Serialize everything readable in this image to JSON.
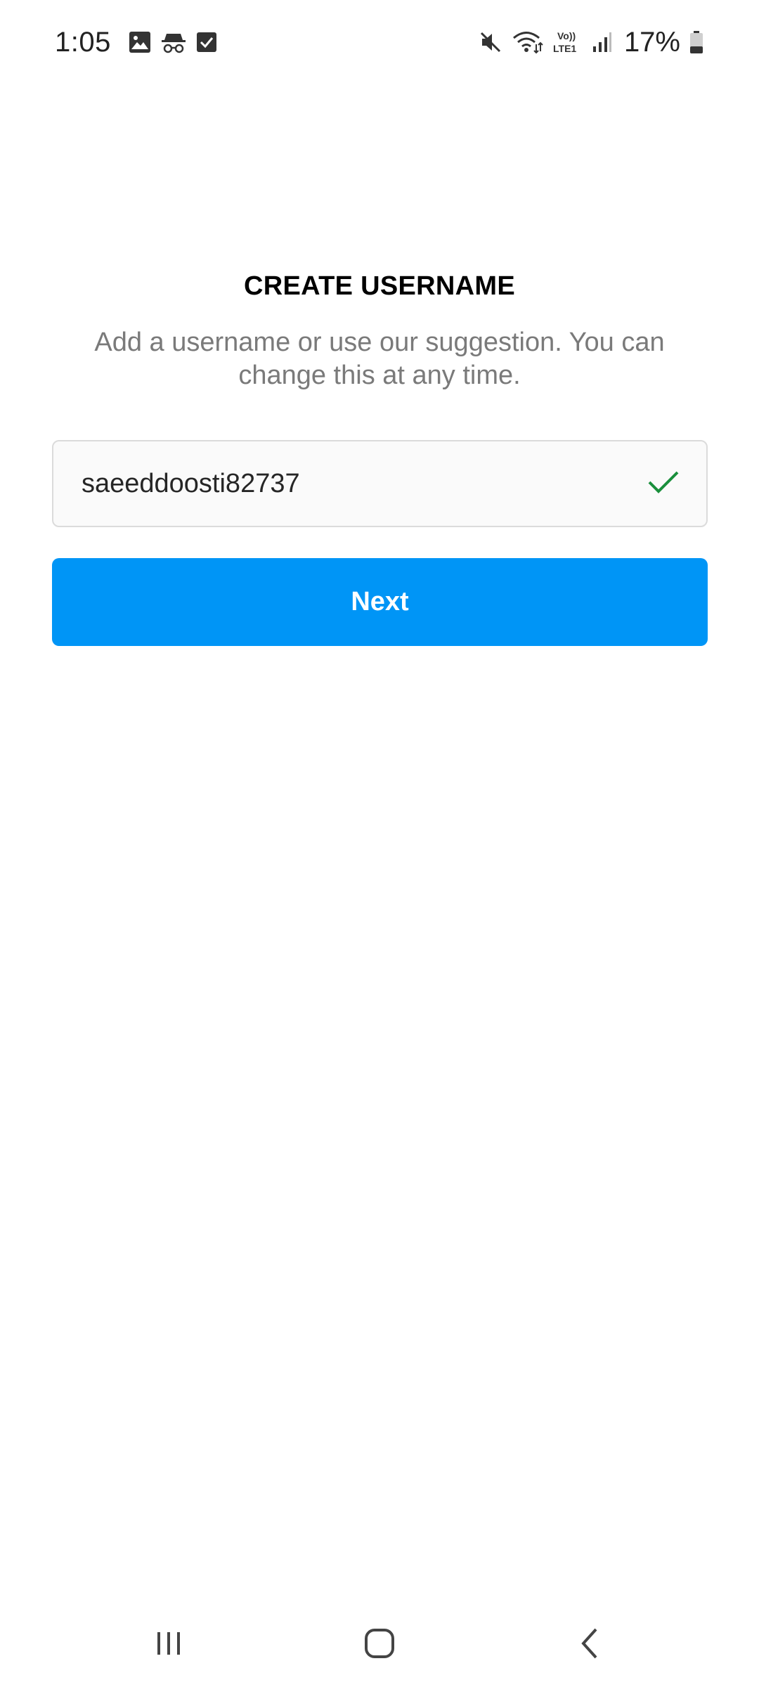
{
  "status_bar": {
    "time": "1:05",
    "left_icons": [
      "gallery-icon",
      "incognito-icon",
      "checkbox-icon"
    ],
    "right_icons": [
      "mute-icon",
      "wifi-icon",
      "volte-icon",
      "signal-icon"
    ],
    "volte_label_top": "Vo))",
    "volte_label_bottom": "LTE1",
    "battery_percent": "17%"
  },
  "page": {
    "title": "CREATE USERNAME",
    "subtitle": "Add a username or use our suggestion. You can change this at any time."
  },
  "username_field": {
    "value": "saeeddoosti82737",
    "valid_icon": "checkmark-icon",
    "valid_color": "#1a8f3c"
  },
  "next_button": {
    "label": "Next",
    "color": "#0095f6"
  },
  "nav_bar": {
    "items": [
      "recent-apps-icon",
      "home-icon",
      "back-icon"
    ]
  }
}
